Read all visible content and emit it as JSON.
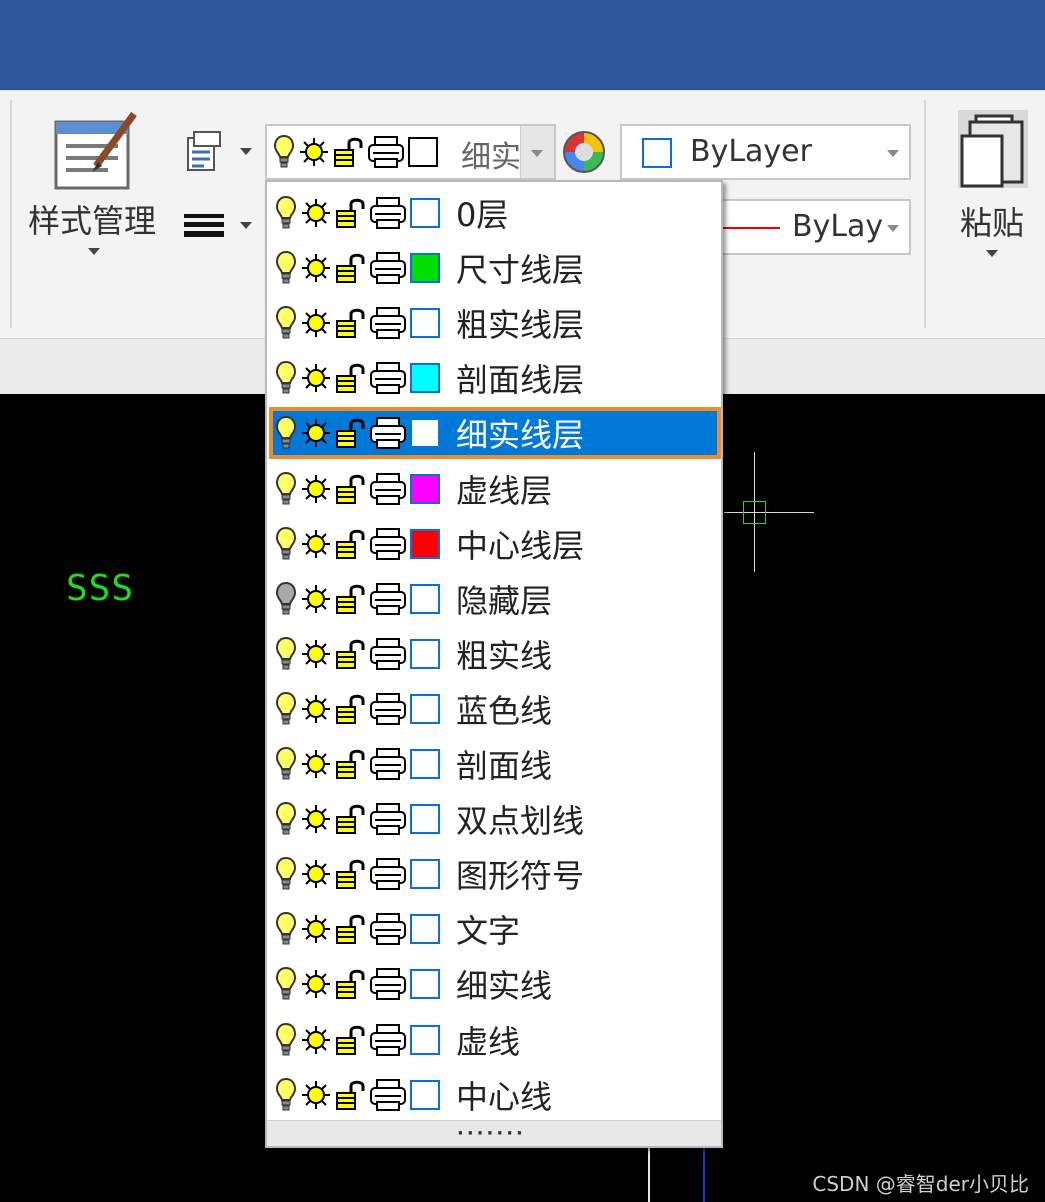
{
  "ribbon": {
    "style_manager_label": "样式管理",
    "paste_label": "粘贴"
  },
  "layer_combo": {
    "current_text": "细实",
    "current_color": "#ffffff"
  },
  "color_combo": {
    "value": "ByLayer",
    "swatch_color": "#ffffff"
  },
  "linetype_combo": {
    "value": "ByLay",
    "line_color": "#e00000"
  },
  "layers": [
    {
      "name": "0层",
      "color": "#ffffff",
      "frozen": false,
      "selected": false
    },
    {
      "name": "尺寸线层",
      "color": "#00e000",
      "frozen": false,
      "selected": false
    },
    {
      "name": "粗实线层",
      "color": "#ffffff",
      "frozen": false,
      "selected": false
    },
    {
      "name": "剖面线层",
      "color": "#00ffff",
      "frozen": false,
      "selected": false
    },
    {
      "name": "细实线层",
      "color": "#ffffff",
      "frozen": false,
      "selected": true
    },
    {
      "name": "虚线层",
      "color": "#ff00ff",
      "frozen": false,
      "selected": false
    },
    {
      "name": "中心线层",
      "color": "#ff0000",
      "frozen": false,
      "selected": false
    },
    {
      "name": "隐藏层",
      "color": "#ffffff",
      "frozen": true,
      "selected": false
    },
    {
      "name": "粗实线",
      "color": "#ffffff",
      "frozen": false,
      "selected": false
    },
    {
      "name": "蓝色线",
      "color": "#ffffff",
      "frozen": false,
      "selected": false
    },
    {
      "name": "剖面线",
      "color": "#ffffff",
      "frozen": false,
      "selected": false
    },
    {
      "name": "双点划线",
      "color": "#ffffff",
      "frozen": false,
      "selected": false
    },
    {
      "name": "图形符号",
      "color": "#ffffff",
      "frozen": false,
      "selected": false
    },
    {
      "name": "文字",
      "color": "#ffffff",
      "frozen": false,
      "selected": false
    },
    {
      "name": "细实线",
      "color": "#ffffff",
      "frozen": false,
      "selected": false
    },
    {
      "name": "虚线",
      "color": "#ffffff",
      "frozen": false,
      "selected": false
    },
    {
      "name": "中心线",
      "color": "#ffffff",
      "frozen": false,
      "selected": false
    }
  ],
  "dropdown_grip": "·······",
  "canvas": {
    "text": "SSS",
    "text_color": "#1fdc1f"
  },
  "watermark": "CSDN @睿智der小贝比",
  "colors": {
    "titlebar": "#2b579a",
    "selection": "#0078d7",
    "selection_outline": "#f08b2c"
  },
  "icons": [
    "lightbulb-icon",
    "sun-icon",
    "lock-icon",
    "printer-icon",
    "color-swatch-icon",
    "color-wheel-icon",
    "style-manager-icon",
    "paste-icon",
    "lineweight-icon",
    "properties-icon"
  ]
}
